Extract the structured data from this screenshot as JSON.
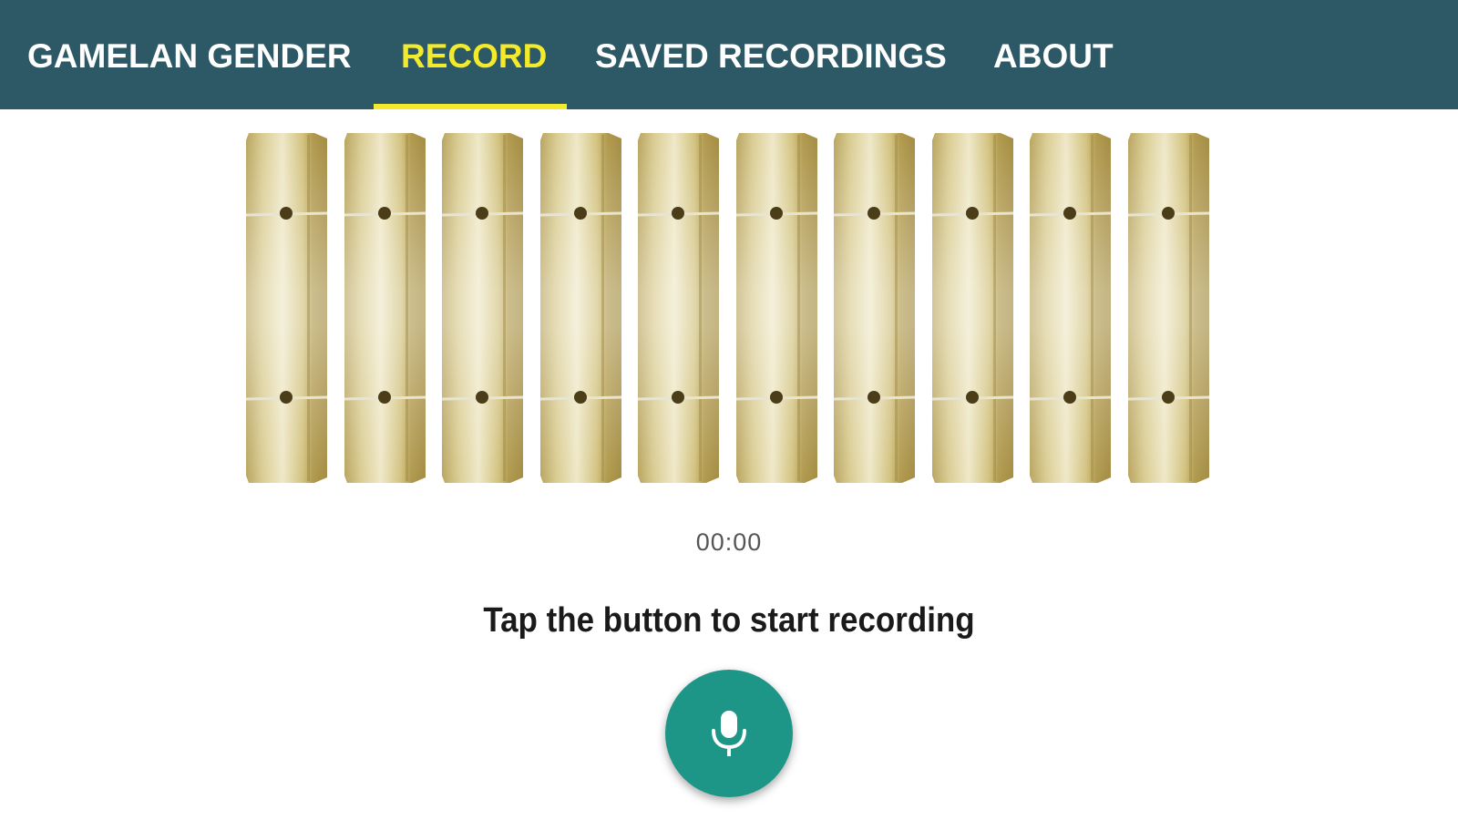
{
  "tabs": [
    {
      "label": "GAMELAN GENDER",
      "active": false
    },
    {
      "label": "RECORD",
      "active": true
    },
    {
      "label": "SAVED RECORDINGS",
      "active": false
    },
    {
      "label": "ABOUT",
      "active": false
    }
  ],
  "instrument": {
    "bar_count": 10
  },
  "recorder": {
    "timer": "00:00",
    "hint": "Tap the button to start recording",
    "button_icon": "microphone-icon"
  },
  "colors": {
    "header_bg": "#2d5866",
    "active_tab": "#f2ea2a",
    "tab_text": "#ffffff",
    "record_button": "#1d9688"
  }
}
